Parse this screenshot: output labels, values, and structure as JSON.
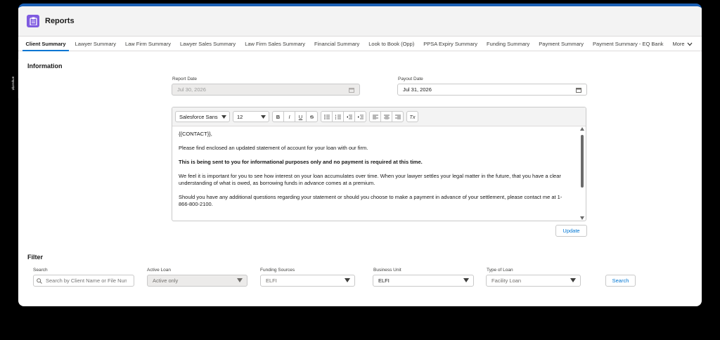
{
  "header": {
    "title": "Reports",
    "icon": "clipboard-icon"
  },
  "tabs": [
    {
      "label": "Client Summary"
    },
    {
      "label": "Lawyer Summary"
    },
    {
      "label": "Law Firm Summary"
    },
    {
      "label": "Lawyer Sales Summary"
    },
    {
      "label": "Law Firm Sales Summary"
    },
    {
      "label": "Financial Summary"
    },
    {
      "label": "Look to Book (Opp)"
    },
    {
      "label": "PPSA Expiry Summary"
    },
    {
      "label": "Funding Summary"
    },
    {
      "label": "Payment Summary"
    },
    {
      "label": "Payment Summary - EQ Bank"
    }
  ],
  "tabs_more": "More",
  "side_tab": {
    "label": "ampscript"
  },
  "information": {
    "title": "Information",
    "report_date_label": "Report Date",
    "report_date_value": "Jul 30, 2026",
    "payout_date_label": "Payout Date",
    "payout_date_value": "Jul 31, 2026"
  },
  "editor": {
    "font": "Salesforce Sans",
    "size": "12",
    "toolbar": {
      "bold": "B",
      "italic": "I",
      "underline": "U",
      "strike": "S",
      "clear": "Tx"
    },
    "paragraphs": [
      "{{CONTACT}},",
      "Please find enclosed an updated statement of account for your loan with our firm.",
      "This is being sent to you for informational purposes only and no payment is required at this time.",
      "We feel it is important for you to see how interest on your loan accumulates over time. When your lawyer settles your legal matter in the future, that you have a clear understanding of what is owed, as borrowing funds in advance comes at a premium.",
      "Should you have any additional questions regarding your statement or should you choose to make a payment in advance of your settlement, please contact me at 1-866-800-2100."
    ]
  },
  "update_button": "Update",
  "filter": {
    "title": "Filter",
    "search_label": "Search",
    "search_placeholder": "Search by Client Name or File Number",
    "active_loan_label": "Active Loan",
    "active_loan_value": "Active only",
    "funding_sources_label": "Funding Sources",
    "funding_sources_value": "ELFI",
    "business_unit_label": "Business Unit",
    "business_unit_value": "ELFI",
    "type_of_loan_label": "Type of Loan",
    "type_of_loan_value": "Facility Loan",
    "search_button": "Search"
  },
  "colors": {
    "accent": "#0176d3",
    "app_icon": "#7f5be0",
    "window_border": "#1b5fb3"
  }
}
